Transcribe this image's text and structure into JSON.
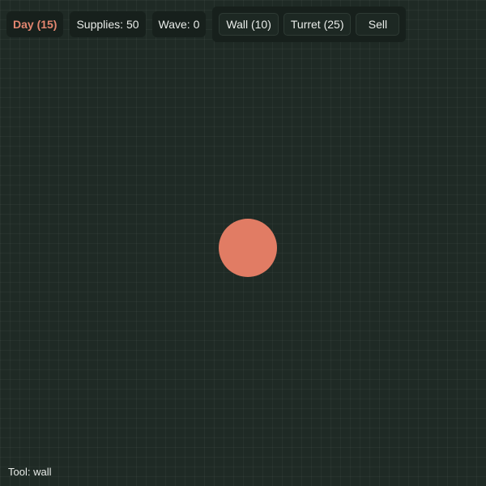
{
  "hud": {
    "day_label": "Day (15)",
    "supplies_label": "Supplies: 50",
    "wave_label": "Wave: 0"
  },
  "toolbar": {
    "wall_label": "Wall (10)",
    "turret_label": "Turret (25)",
    "sell_label": "Sell"
  },
  "status": {
    "tool_label": "Tool: wall"
  },
  "colors": {
    "background": "#1f2a25",
    "day_accent": "#e38670",
    "base": "#e17c64",
    "panel": "#17201c"
  }
}
